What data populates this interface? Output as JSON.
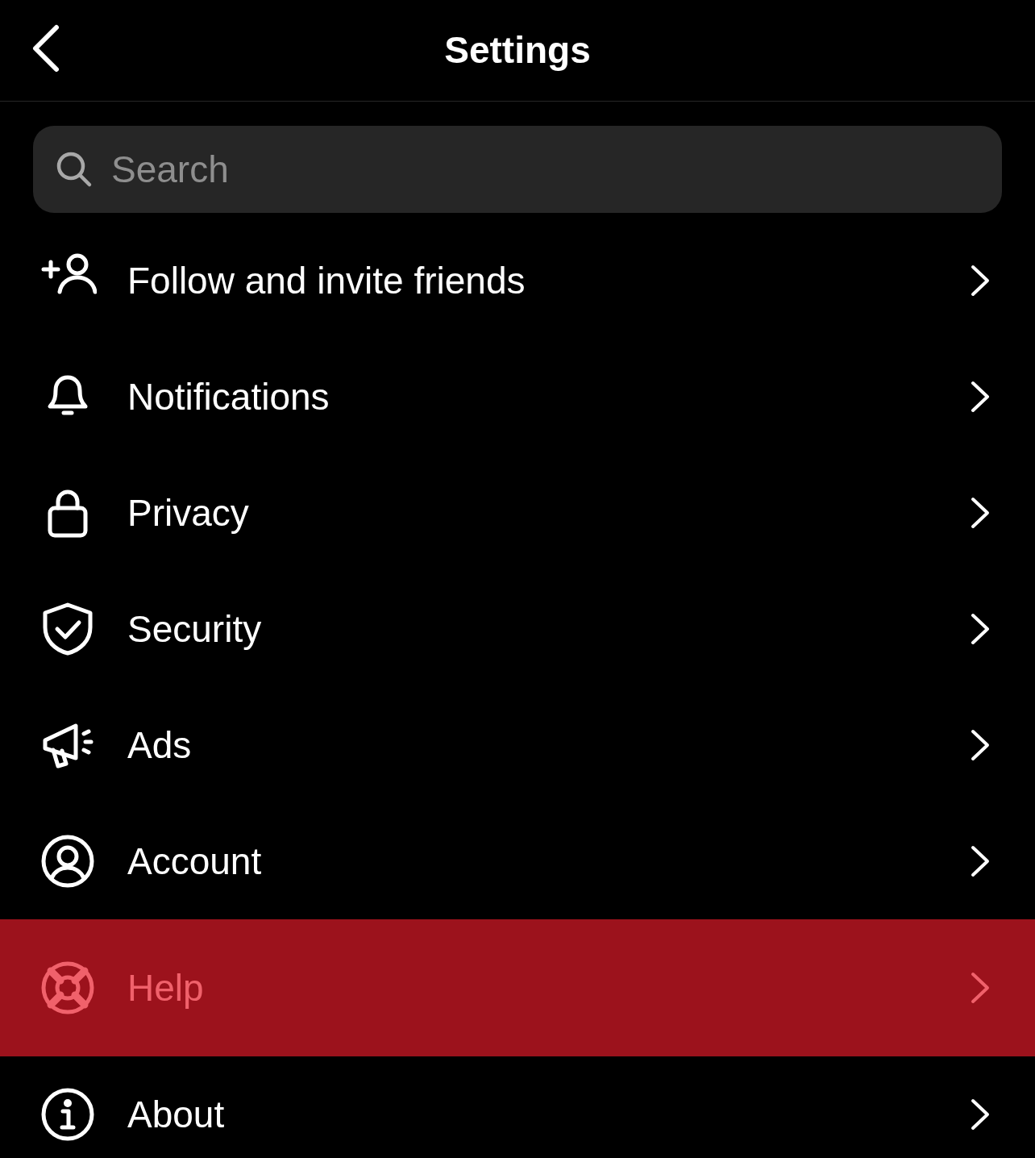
{
  "header": {
    "title": "Settings"
  },
  "search": {
    "placeholder": "Search"
  },
  "items": [
    {
      "label": "Follow and invite friends",
      "selected": false
    },
    {
      "label": "Notifications",
      "selected": false
    },
    {
      "label": "Privacy",
      "selected": false
    },
    {
      "label": "Security",
      "selected": false
    },
    {
      "label": "Ads",
      "selected": false
    },
    {
      "label": "Account",
      "selected": false
    },
    {
      "label": "Help",
      "selected": true
    },
    {
      "label": "About",
      "selected": false
    }
  ]
}
